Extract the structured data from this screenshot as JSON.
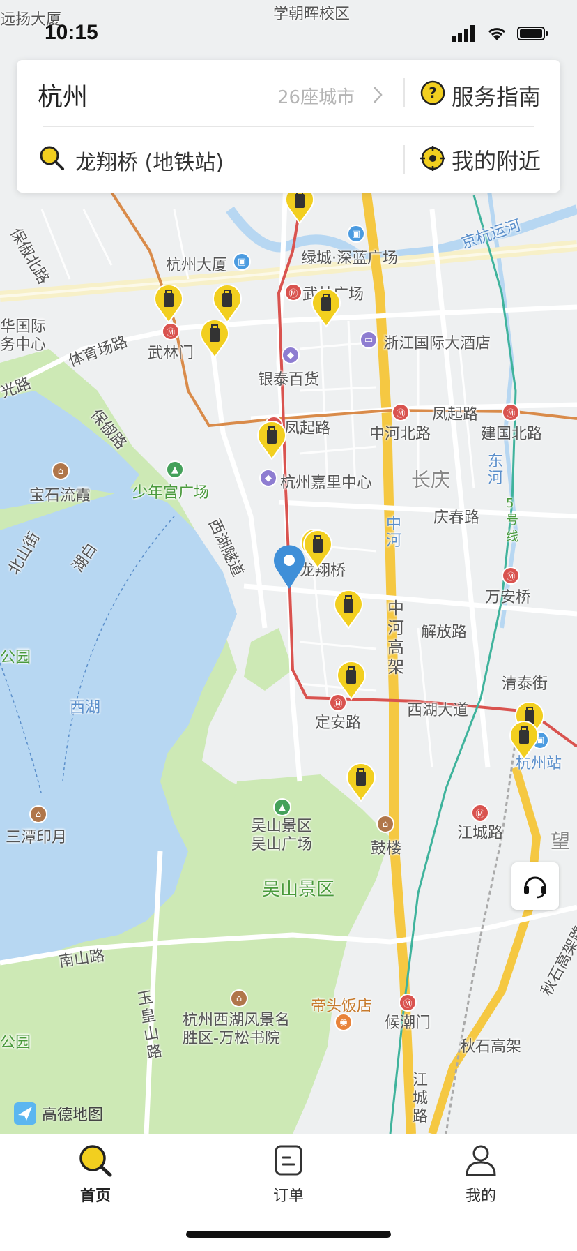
{
  "status_bar": {
    "time": "10:15"
  },
  "search_card": {
    "city": "杭州",
    "city_count": "26座城市",
    "service_guide": "服务指南",
    "location_text": "龙翔桥 (地铁站)",
    "nearby": "我的附近"
  },
  "map": {
    "labels": {
      "yuanyang": "远扬大厦",
      "xuechao": "学朝晖校区",
      "hzdasha": "杭州大厦",
      "lvcheng": "绿城·深蓝广场",
      "jinghang": "京杭运河",
      "wulin_sq": "武林广场",
      "wulinmen": "武林门",
      "zj_hotel": "浙江国际大酒店",
      "intl_center": "华国际\n务中心",
      "tiyu": "体育场路",
      "yintai": "银泰百货",
      "guangluo": "光路",
      "baochu": "保俶路",
      "baochu_n": "保俶北路",
      "fengqi_w": "凤起路",
      "fengqi_e": "凤起路",
      "zhonghe_n": "中河北路",
      "jianguo_n": "建国北路",
      "baoshi": "宝石流霞",
      "shaonian": "少年宫广场",
      "jiali": "杭州嘉里中心",
      "changqing": "长庆",
      "dong_he": "东河",
      "qingchun": "庆春路",
      "line5": "5号线",
      "beishan": "北山街",
      "hubin": "湖白",
      "xihu_tunnel": "西湖隧道",
      "zhonghe": "中河",
      "longxiang": "龙翔桥",
      "wan_an": "万安桥",
      "zhonghe_gaojia": "中河高架",
      "jiefang": "解放路",
      "park": "公园",
      "xihu": "西湖",
      "qingtai": "清泰街",
      "xihu_dadao": "西湖大道",
      "ding_an": "定安路",
      "hz_station": "杭州站",
      "santan": "三潭印月",
      "wushan_sq": "吴山景区\n吴山广场",
      "gulou": "鼓楼",
      "jiangcheng": "江城路",
      "wang": "望",
      "wushan": "吴山景区",
      "nanshan": "南山路",
      "yuhuang": "玉皇山路",
      "dihou": "帝头饭店",
      "houchao": "候潮门",
      "wansong": "杭州西湖风景名\n胜区-万松书院",
      "qiushi": "秋石高架",
      "qiushi_road": "秋石高架路",
      "jiangcheng2": "江城路",
      "park2": "公园"
    },
    "logo": "高德地图"
  },
  "tabbar": {
    "home": "首页",
    "orders": "订单",
    "mine": "我的"
  },
  "icons": {
    "service": "headset-icon",
    "search": "search-icon",
    "guide": "question-icon",
    "nearby": "locate-icon",
    "cabinet": "luggage-icon",
    "location_pin": "location-pin-icon"
  },
  "colors": {
    "accent": "#f2cf1f",
    "metro": "#d9534f",
    "water": "#b7d7f2",
    "park": "#cbe8b4",
    "highway": "#f5c842",
    "pin_blue": "#3f8fd8"
  }
}
